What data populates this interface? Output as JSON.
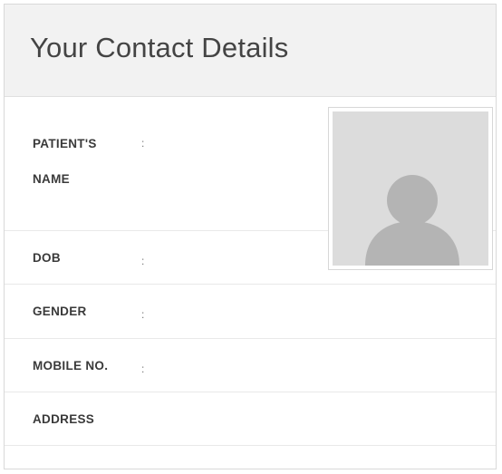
{
  "card": {
    "title": "Your Contact Details"
  },
  "fields": {
    "patient_name": {
      "label": "PATIENT'S NAME",
      "separator": ":",
      "value": ""
    },
    "dob": {
      "label": "DOB",
      "separator": ":",
      "value": ""
    },
    "gender": {
      "label": "GENDER",
      "separator": ":",
      "value": ""
    },
    "mobile": {
      "label": "MOBILE NO.",
      "separator": ":",
      "value": ""
    },
    "address": {
      "label": "ADDRESS",
      "separator": "",
      "value": ""
    }
  },
  "avatar": {
    "icon": "user-silhouette-icon",
    "background_color": "#dcdcdc",
    "silhouette_color": "#b4b4b4"
  },
  "colors": {
    "header_background": "#f2f2f2",
    "title_text": "#444444",
    "label_text": "#3a3a3a",
    "divider": "#e9e9e9"
  }
}
